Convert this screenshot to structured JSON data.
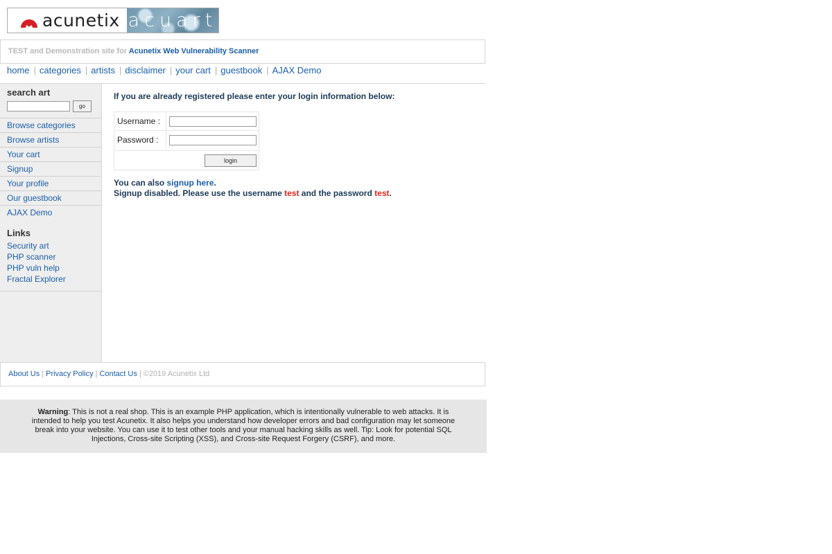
{
  "logo": {
    "brand": "acunetix",
    "product": "acuart"
  },
  "subtitle": {
    "prefix": "TEST and Demonstration site for",
    "link": "Acunetix Web Vulnerability Scanner"
  },
  "topnav": [
    "home",
    "categories",
    "artists",
    "disclaimer",
    "your cart",
    "guestbook",
    "AJAX Demo"
  ],
  "sidebar": {
    "search_title": "search art",
    "search_placeholder": "",
    "go_label": "go",
    "menu": [
      "Browse categories",
      "Browse artists",
      "Your cart",
      "Signup",
      "Your profile",
      "Our guestbook",
      "AJAX Demo"
    ],
    "links_title": "Links",
    "links": [
      "Security art",
      "PHP scanner",
      "PHP vuln help",
      "Fractal Explorer"
    ]
  },
  "main": {
    "intro": "If you are already registered please enter your login information below:",
    "username_label": "Username :",
    "password_label": "Password :",
    "login_label": "login",
    "signup_prefix": "You can also",
    "signup_link": "signup here",
    "signup_suffix": ".",
    "disabled_prefix": "Signup disabled. Please use the username",
    "test_user": "test",
    "disabled_mid": "and the password",
    "test_pass": "test",
    "disabled_suffix": "."
  },
  "footer": {
    "links": [
      "About Us",
      "Privacy Policy",
      "Contact Us"
    ],
    "copyright": "©2019 Acunetix Ltd"
  },
  "warning": {
    "label": "Warning",
    "text": ": This is not a real shop. This is an example PHP application, which is intentionally vulnerable to web attacks. It is intended to help you test Acunetix. It also helps you understand how developer errors and bad configuration may let someone break into your website. You can use it to test other tools and your manual hacking skills as well. Tip: Look for potential SQL Injections, Cross-site Scripting (XSS), and Cross-site Request Forgery (CSRF), and more."
  },
  "colors": {
    "link": "#1a5ea8",
    "highlight": "#e0261e",
    "sidebar_bg": "#eeeeee",
    "warning_bg": "#e6e6e6"
  }
}
